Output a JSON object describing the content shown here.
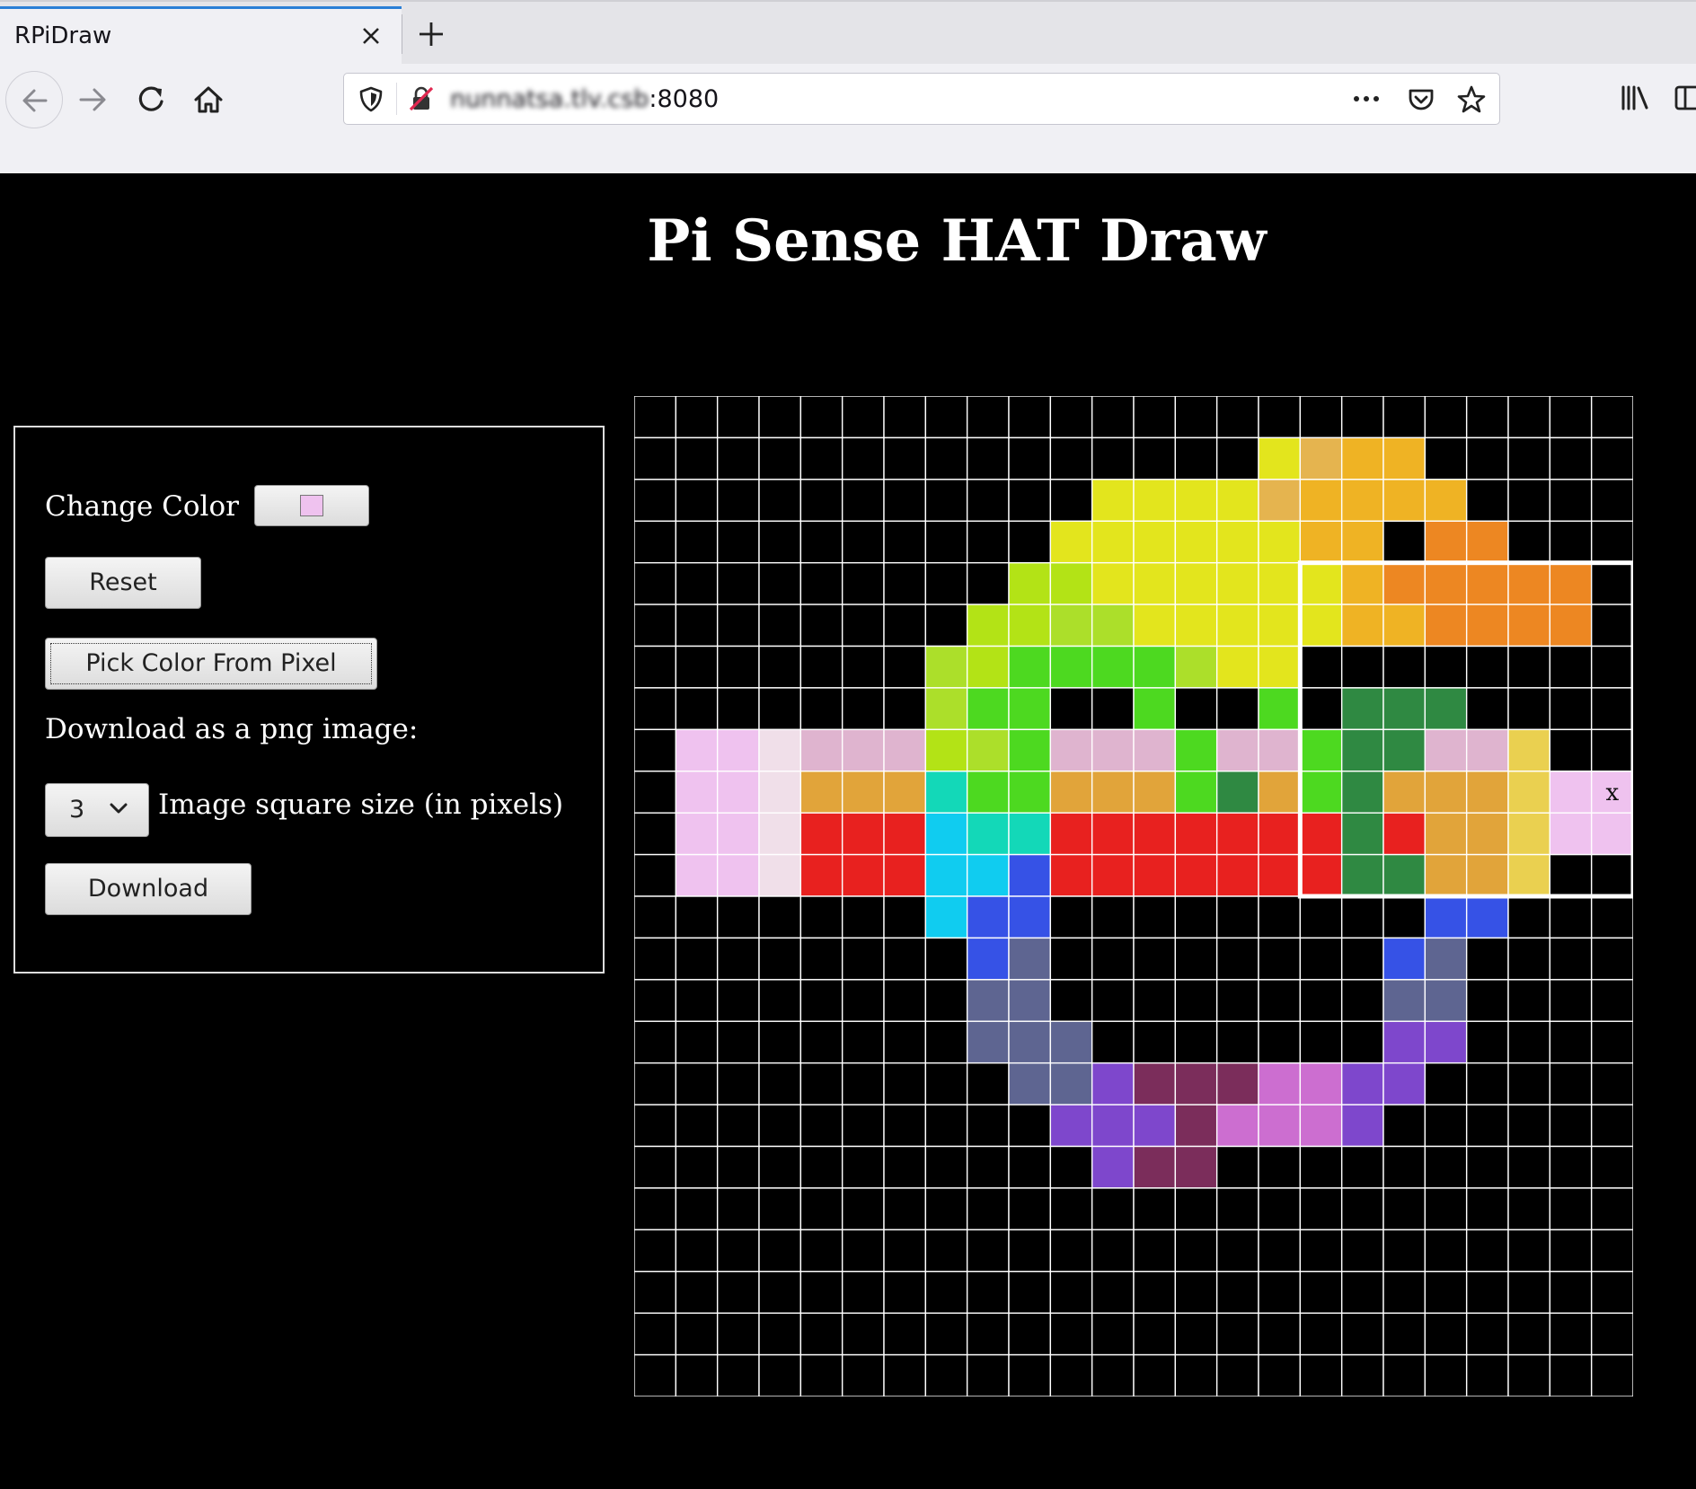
{
  "browser": {
    "tab_title": "RPiDraw",
    "url_blurred": "nunnatsa.tlv.csb",
    "url_port": ":8080",
    "icons": [
      "close-icon",
      "plus-icon",
      "back-arrow-icon",
      "forward-arrow-icon",
      "reload-icon",
      "home-icon",
      "shield-icon",
      "insecure-lock-icon",
      "more-dots-icon",
      "pocket-icon",
      "star-icon",
      "library-icon",
      "sidebar-icon"
    ]
  },
  "page": {
    "title": "Pi Sense HAT Draw"
  },
  "controls": {
    "change_color_label": "Change Color",
    "current_color": "#efc2ef",
    "reset_label": "Reset",
    "pick_color_label": "Pick Color From Pixel",
    "download_label_text": "Download as a png image:",
    "size_selected": "3",
    "size_label": "Image square size (in pixels)",
    "download_button_label": "Download"
  },
  "grid": {
    "columns": 24,
    "rows": 24,
    "selection": {
      "col_start": 16,
      "row_start": 4,
      "cols": 8,
      "rows": 8
    },
    "marked_cell": {
      "col": 23,
      "row": 9,
      "mark": "x"
    },
    "palette": {
      "k": "#000000",
      "Y": "#e3e51d",
      "T": "#e5b44f",
      "O": "#efb324",
      "F": "#ed8722",
      "L": "#b3e316",
      "Q": "#acdf2a",
      "G": "#4dd920",
      "D": "#2f8942",
      "P": "#efc2ef",
      "p": "#f0dfe9",
      "R": "#dfb4cf",
      "A": "#e1a43a",
      "S": "#ead050",
      "E": "#13d8b8",
      "C": "#10ccf0",
      "r": "#e8211f",
      "B": "#3652e6",
      "V": "#5e6591",
      "U": "#7e47cc",
      "M": "#7b2d5b",
      "W": "#cc6ed0"
    },
    "cells": [
      "kkkkkkkkkkkkkkkkkkkkkkkk",
      "kkkkkkkkkkkkkkkYTOOkkkkk",
      "kkkkkkkkkkkYYYYTOOOOkkkk",
      "kkkkkkkkkkYYYYYYOOkFFkkk",
      "kkkkkkkkkLLYYYYYYOFFFFFk",
      "kkkkkkkkLLQQYYYYYOOFFFFk",
      "kkkkkkkQLGGGGQYYkkkkkkkk",
      "kkkkkkkQGGkkGkkGkDDDkkkk",
      "kPPpRRRLQGRRRGRRGDDRRSkk",
      "kPPpAAAEGGAAAGDAGDAAASPP",
      "kPPprrrCEErrrrrrrDrAASPP",
      "kPPprrrCCBrrrrrrrDDAASkk",
      "kkkkkkkCBBkkkkkkkkkBBkkk",
      "kkkkkkkkBVkkkkkkkkBVkkkk",
      "kkkkkkkkVVkkkkkkkkVVkkkk",
      "kkkkkkkkVVVkkkkkkkUUkkkk",
      "kkkkkkkkkVVUMMMWWUUkkkkk",
      "kkkkkkkkkkUUUMWWWUkkkkkk",
      "kkkkkkkkkkkUMMkkkkkkkkkk",
      "kkkkkkkkkkkkkkkkkkkkkkkk",
      "kkkkkkkkkkkkkkkkkkkkkkkk",
      "kkkkkkkkkkkkkkkkkkkkkkkk",
      "kkkkkkkkkkkkkkkkkkkkkkkk",
      "kkkkkkkkkkkkkkkkkkkkkkkk"
    ]
  }
}
